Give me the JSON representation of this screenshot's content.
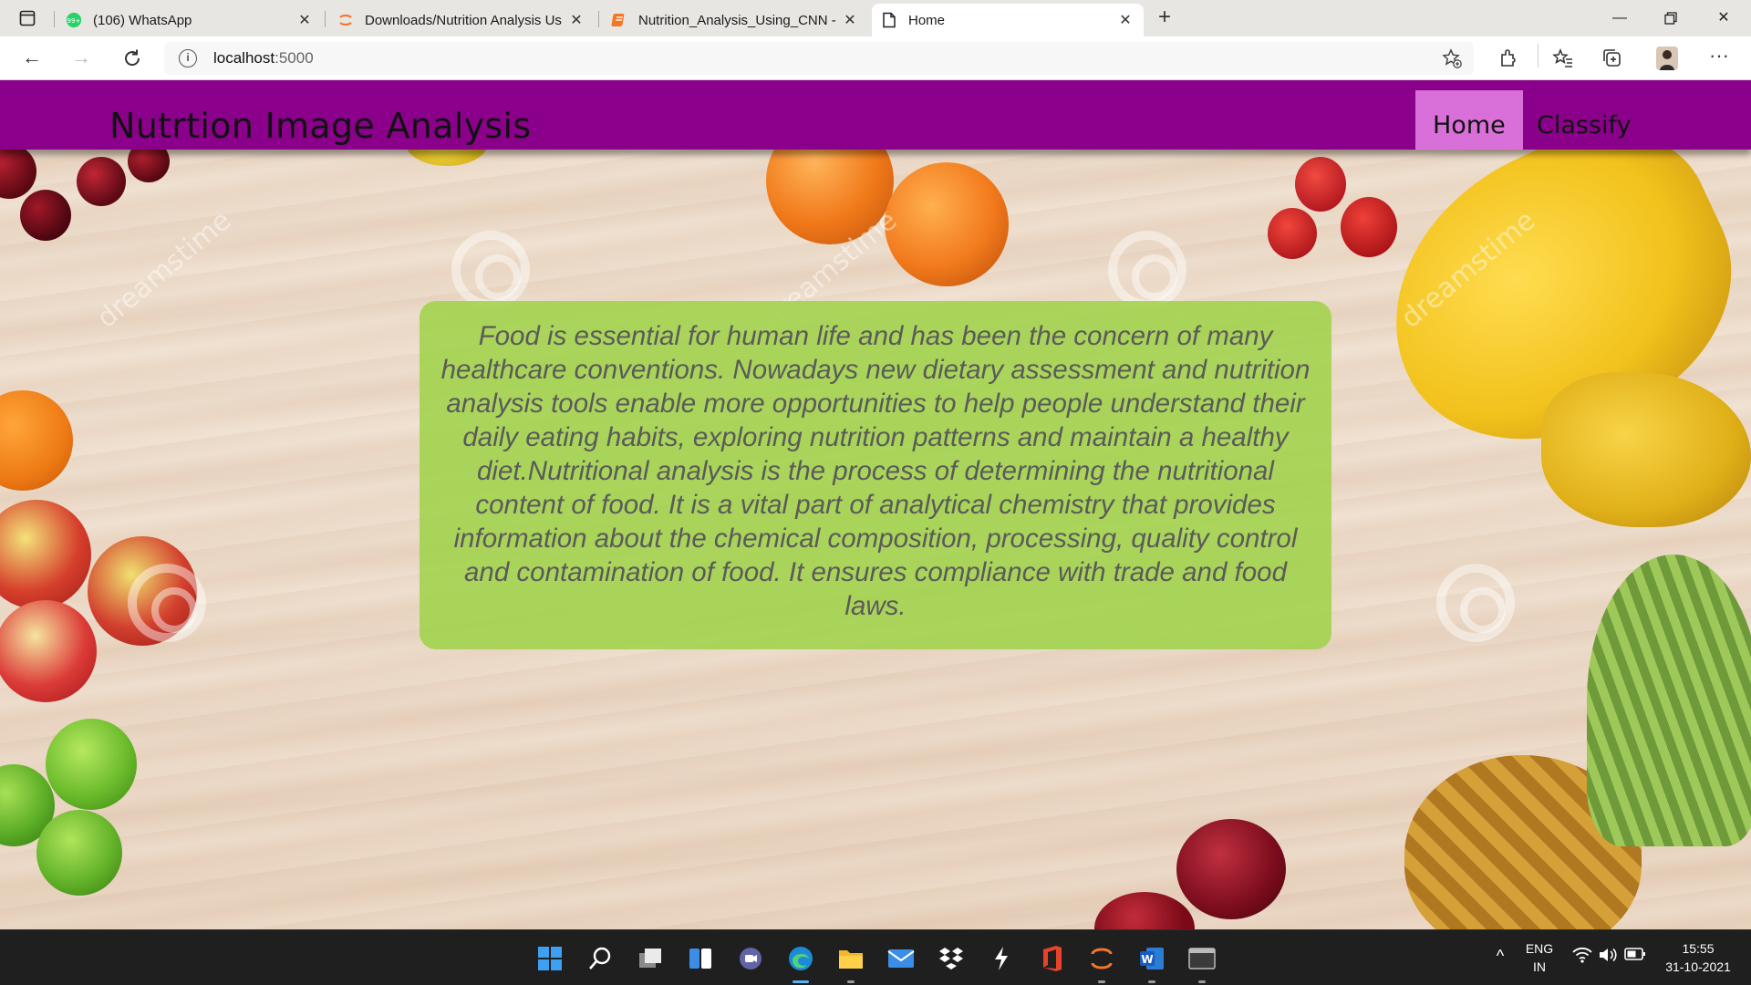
{
  "browser": {
    "tabs": [
      {
        "title": "(106) WhatsApp",
        "favicon": "whatsapp-icon",
        "badge": "99+"
      },
      {
        "title": "Downloads/Nutrition Analysis Us",
        "favicon": "jupyter-icon"
      },
      {
        "title": "Nutrition_Analysis_Using_CNN -",
        "favicon": "jupyter-notebook-icon"
      },
      {
        "title": "Home",
        "favicon": "page-icon",
        "active": true
      }
    ],
    "address": {
      "host": "localhost",
      "port": ":5000"
    }
  },
  "site": {
    "brand": "Nutrtion Image Analysis",
    "nav": [
      {
        "label": "Home",
        "active": true
      },
      {
        "label": "Classify",
        "active": false
      }
    ],
    "description": "Food is essential for human life and has been the concern of many healthcare conventions. Nowadays new dietary assessment and nutrition analysis tools enable more opportunities to help people understand their daily eating habits, exploring nutrition patterns and maintain a healthy diet.Nutritional analysis is the process of determining the nutritional content of food. It is a vital part of analytical chemistry that provides information about the chemical composition, processing, quality control and contamination of food. It ensures compliance with trade and food laws.",
    "watermark": "dreamstime"
  },
  "taskbar": {
    "apps": [
      "windows-start-icon",
      "search-icon",
      "task-view-icon",
      "widgets-icon",
      "teams-chat-icon",
      "edge-icon",
      "file-explorer-icon",
      "mail-icon",
      "dropbox-icon",
      "app-icon",
      "office-icon",
      "jupyter-icon",
      "word-icon",
      "terminal-icon"
    ],
    "language_line1": "ENG",
    "language_line2": "IN",
    "time": "15:55",
    "date": "31-10-2021"
  },
  "colors": {
    "navbar": "#8b008b",
    "nav_active": "#d970d9",
    "description_box": "#9ed246"
  }
}
